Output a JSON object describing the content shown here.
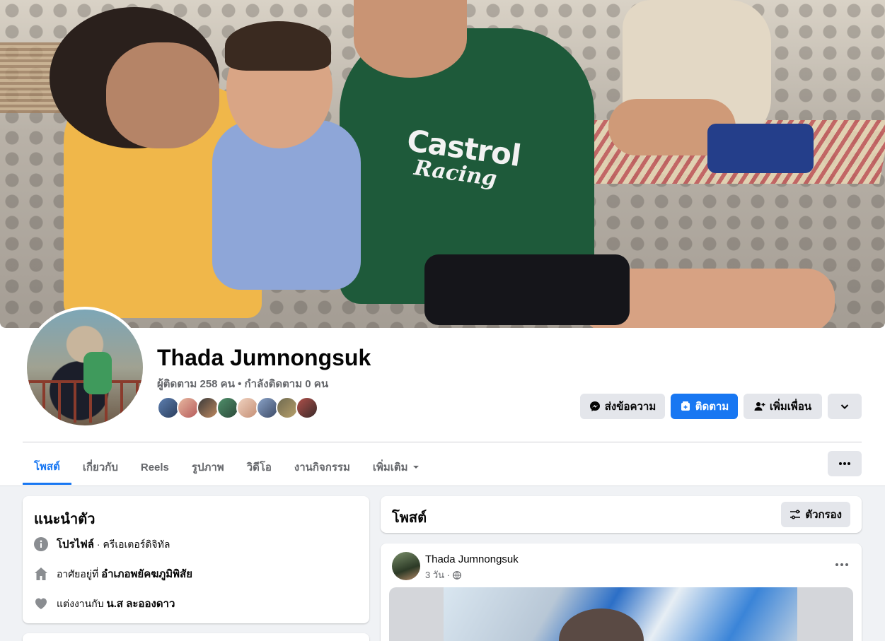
{
  "profile": {
    "name": "Thada Jumnongsuk",
    "followers_text": "ผู้ติดตาม 258 คน • กำลังติดตาม 0 คน"
  },
  "cover": {
    "shirt_text": "Castrol",
    "shirt_text2": "Racing"
  },
  "actions": {
    "message": "ส่งข้อความ",
    "follow": "ติดตาม",
    "add_friend": "เพิ่มเพื่อน"
  },
  "tabs": [
    {
      "label": "โพสต์",
      "active": true
    },
    {
      "label": "เกี่ยวกับ"
    },
    {
      "label": "Reels"
    },
    {
      "label": "รูปภาพ"
    },
    {
      "label": "วิดีโอ"
    },
    {
      "label": "งานกิจกรรม"
    },
    {
      "label": "เพิ่มเติม"
    }
  ],
  "intro": {
    "title": "แนะนำตัว",
    "profile_label": "โปรไฟล์",
    "profile_value": " · ครีเอเตอร์ดิจิทัล",
    "lives_prefix": "อาศัยอยู่ที่ ",
    "lives_value": "อำเภอพยัคฆภูมิพิสัย",
    "married_prefix": "แต่งงานกับ ",
    "married_value": "น.ส ละอองดาว"
  },
  "posts": {
    "title": "โพสต์",
    "filter_label": "ตัวกรอง"
  },
  "post": {
    "author": "Thada Jumnongsuk",
    "time": "3 วัน ·"
  },
  "colors": {
    "accent": "#1877f2",
    "secondary_text": "#65676b",
    "button_gray": "#e4e6eb",
    "page_bg": "#f0f2f5"
  },
  "icons": [
    "messenger-icon",
    "follow-icon",
    "add-friend-icon",
    "chevron-down-icon",
    "more-icon",
    "info-icon",
    "home-icon",
    "heart-icon",
    "filter-icon",
    "globe-icon"
  ]
}
